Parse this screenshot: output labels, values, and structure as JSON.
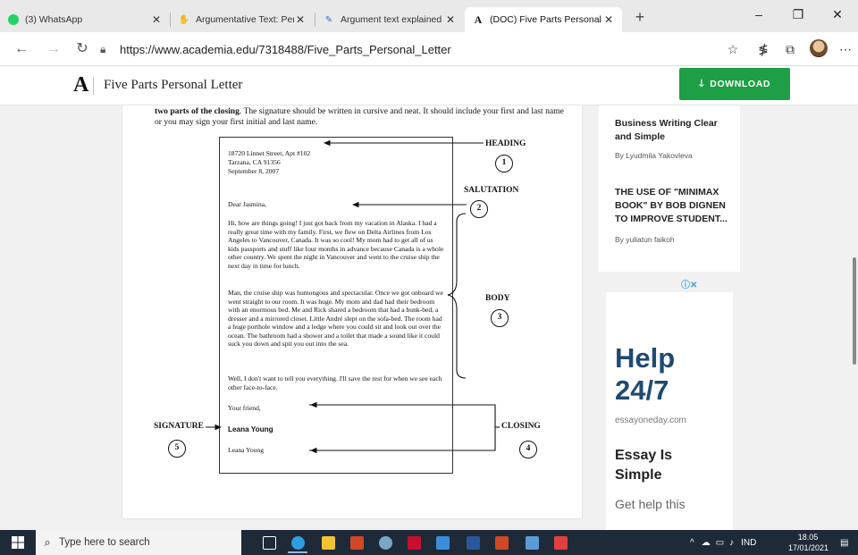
{
  "browser": {
    "tabs": [
      {
        "title": "(3) WhatsApp",
        "icon": "whatsapp-icon",
        "color": "#25d366"
      },
      {
        "title": "Argumentative Text: Pengertian, ",
        "icon": "hand-icon",
        "color": "#f4a416"
      },
      {
        "title": "Argument text explained for prim",
        "icon": "pencil-icon",
        "color": "#2b6fd6"
      },
      {
        "title": "(DOC) Five Parts Personal Letter",
        "icon": "academia-icon",
        "color": "#111111"
      }
    ],
    "new_tab": "+",
    "window_controls": {
      "minimize": "–",
      "restore": "❐",
      "close": "✕"
    },
    "url": "https://www.academia.edu/7318488/Five_Parts_Personal_Letter"
  },
  "site": {
    "logo": "A",
    "doc_title": "Five Parts Personal Letter",
    "download_label": "DOWNLOAD",
    "download_color": "#1e9e45"
  },
  "document": {
    "intro_bold": "two parts of the closing",
    "intro_rest": ". The signature should be written in cursive and neat. It should include your first and last name or you may sign your first initial and last name.",
    "letter": {
      "heading_lines": [
        "18720 Linnet Street, Apt #102",
        "Tarzana, CA  91356",
        "September 8, 2007"
      ],
      "salutation": "Dear Jasmina,",
      "body_p1": "Hi, how are things going!  I just got back from my vacation in Alaska.  I had a really great time with my family.  First, we flew on Delta Airlines from Los Angeles to Vancouver, Canada.  It was so cool!  My mom had to get all of us kids passports and stuff like four months in advance because Canada is a whole other country.  We spent the night in Vancouver and went to the cruise ship the next day in time for lunch.",
      "body_p2": "Man, the cruise ship was humongous and spectacular.  Once we got onboard we went straight to our room.  It was huge.  My mom and dad had their bedroom with an enormous bed.  Me and Rick shared a bedroom that had a bunk-bed, a dresser and a mirrored closet.  Little André slept on the sofa-bed.  The room had a huge porthole window and a ledge where you could sit and look out over the ocean.  The bathroom had a shower and a toilet that made a sound like it could suck you  down and spit you out into the sea.",
      "body_p3": "Well, I don't want to tell you everything.  I'll save the rest for when we see each other face-to-face.",
      "closing": "Your friend,",
      "signature": "Leana Young",
      "printed_name": "Leana Young"
    },
    "labels": {
      "heading": "HEADING",
      "heading_num": "1",
      "salutation": "SALUTATION",
      "salutation_num": "2",
      "body": "BODY",
      "body_num": "3",
      "closing": "CLOSING",
      "closing_num": "4",
      "signature": "SIGNATURE",
      "signature_num": "5"
    }
  },
  "sidebar": {
    "related": [
      {
        "title": "Business Writing Clear and Simple",
        "author": "By Lyudmila Yakovleva"
      },
      {
        "title": "THE USE OF \"MINIMAX BOOK\" BY BOB DIGNEN TO IMPROVE STUDENT...",
        "author": "By yuliatun faikoh"
      }
    ],
    "ad": {
      "choices": "ⓘ✕",
      "help_line1": "Help",
      "help_line2": "24/7",
      "domain": "essayoneday.com",
      "headline": "Essay Is Simple",
      "sub": "Get help this"
    }
  },
  "taskbar": {
    "search_placeholder": "Type here to search",
    "apps": [
      {
        "name": "task-view",
        "color": "#ffffff"
      },
      {
        "name": "edge",
        "color": "#2f9de0"
      },
      {
        "name": "file-explorer",
        "color": "#f3c233"
      },
      {
        "name": "powerpoint-red",
        "color": "#d24726"
      },
      {
        "name": "camera",
        "color": "#7aa6c8"
      },
      {
        "name": "mcafee",
        "color": "#c8102e"
      },
      {
        "name": "mail",
        "color": "#3b8fd9"
      },
      {
        "name": "word",
        "color": "#2b579a"
      },
      {
        "name": "powerpoint",
        "color": "#d24726"
      },
      {
        "name": "onenote-like",
        "color": "#5b9bd5"
      },
      {
        "name": "paint-like",
        "color": "#e04040"
      }
    ],
    "language": "IND",
    "time": "18.05",
    "date": "17/01/2021"
  }
}
